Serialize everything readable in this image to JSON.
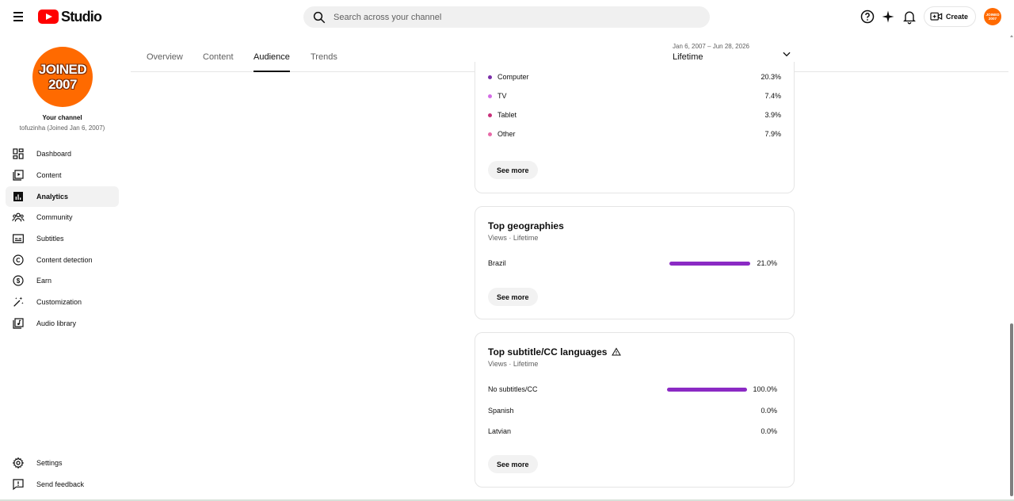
{
  "header": {
    "app_name": "Studio",
    "search_placeholder": "Search across your channel",
    "create_label": "Create",
    "avatar_text": "JOINED 2007"
  },
  "sidebar": {
    "avatar_lines": [
      "JOINED",
      "2007"
    ],
    "channel_title": "Your channel",
    "channel_subtitle": "tofuzinha (Joined Jan 6, 2007)",
    "items": [
      {
        "label": "Dashboard",
        "icon": "dashboard-icon"
      },
      {
        "label": "Content",
        "icon": "content-icon"
      },
      {
        "label": "Analytics",
        "icon": "analytics-icon",
        "active": true
      },
      {
        "label": "Community",
        "icon": "community-icon"
      },
      {
        "label": "Subtitles",
        "icon": "subtitles-icon"
      },
      {
        "label": "Content detection",
        "icon": "copyright-icon"
      },
      {
        "label": "Earn",
        "icon": "dollar-icon"
      },
      {
        "label": "Customization",
        "icon": "magic-wand-icon"
      },
      {
        "label": "Audio library",
        "icon": "audio-library-icon"
      }
    ],
    "bottom_items": [
      {
        "label": "Settings",
        "icon": "gear-icon"
      },
      {
        "label": "Send feedback",
        "icon": "feedback-icon"
      }
    ]
  },
  "tabs": {
    "items": [
      "Overview",
      "Content",
      "Audience",
      "Trends"
    ],
    "active": "Audience"
  },
  "date_range": {
    "range": "Jan 6, 2007 – Jun 28, 2026",
    "label": "Lifetime"
  },
  "device_type": {
    "rows": [
      {
        "label": "Computer",
        "value": "20.3%",
        "color": "#7b2fa8"
      },
      {
        "label": "TV",
        "value": "7.4%",
        "color": "#d46de6"
      },
      {
        "label": "Tablet",
        "value": "3.9%",
        "color": "#c8307a"
      },
      {
        "label": "Other",
        "value": "7.9%",
        "color": "#e86aa8"
      }
    ],
    "see_more": "See more"
  },
  "top_geographies": {
    "title": "Top geographies",
    "subtitle": "Views · Lifetime",
    "rows": [
      {
        "label": "Brazil",
        "value": "21.0%",
        "fraction": 1.0
      }
    ],
    "see_more": "See more"
  },
  "top_languages": {
    "title": "Top subtitle/CC languages",
    "subtitle": "Views · Lifetime",
    "rows": [
      {
        "label": "No subtitles/CC",
        "value": "100.0%",
        "fraction": 1.0
      },
      {
        "label": "Spanish",
        "value": "0.0%",
        "fraction": 0
      },
      {
        "label": "Latvian",
        "value": "0.0%",
        "fraction": 0
      }
    ],
    "see_more": "See more"
  },
  "colors": {
    "brand_red": "#ff0000",
    "bar_purple": "#8b2ac4",
    "avatar_orange": "#ff6a00"
  }
}
